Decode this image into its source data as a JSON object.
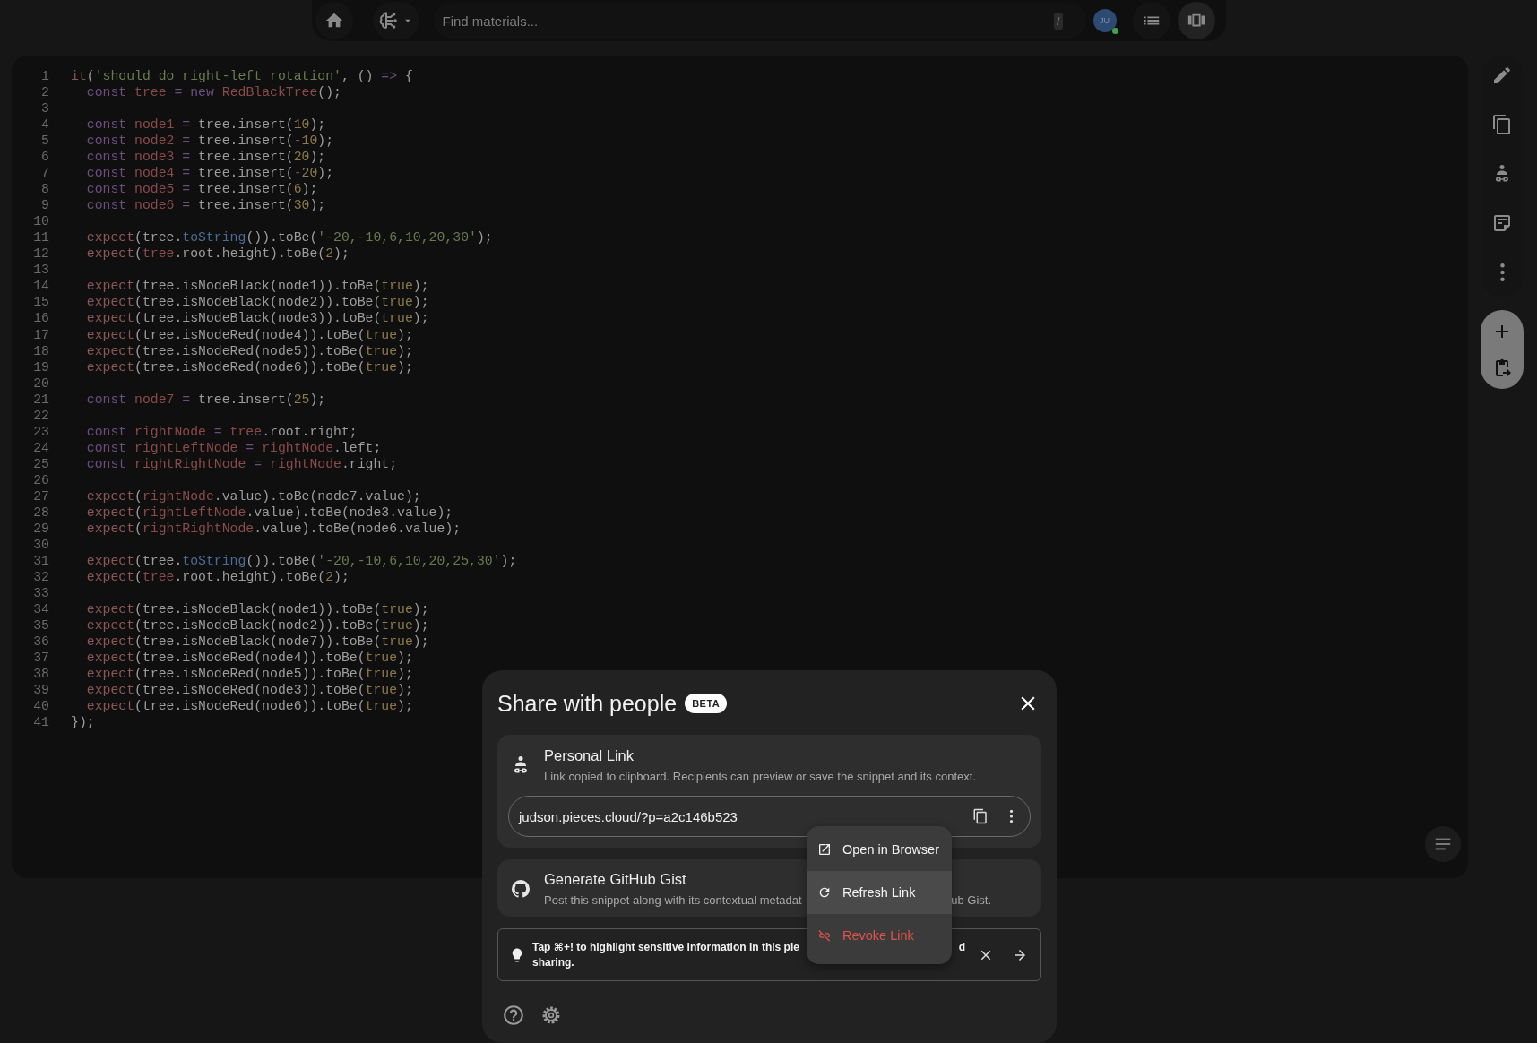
{
  "top_bar": {
    "search": {
      "placeholder": "Find materials..."
    },
    "shortcut": "/",
    "avatar": {
      "initials": "JU",
      "online": true
    }
  },
  "editor": {
    "lines": [
      {
        "number": "1",
        "tokens": [
          {
            "text": "it",
            "kind": "fn"
          },
          {
            "text": "(",
            "kind": "plain"
          },
          {
            "text": "'should do right-left rotation'",
            "kind": "str"
          },
          {
            "text": ", () ",
            "kind": "plain"
          },
          {
            "text": "=>",
            "kind": "kw"
          },
          {
            "text": " {",
            "kind": "plain"
          }
        ]
      },
      {
        "number": "2",
        "tokens": [
          {
            "text": "  const ",
            "kind": "kw"
          },
          {
            "text": "tree",
            "kind": "var"
          },
          {
            "text": " = new ",
            "kind": "kw"
          },
          {
            "text": "RedBlackTree",
            "kind": "var"
          },
          {
            "text": "();",
            "kind": "plain"
          }
        ]
      },
      {
        "number": "3"
      },
      {
        "number": "4",
        "tokens": [
          {
            "text": "  const ",
            "kind": "kw"
          },
          {
            "text": "node1",
            "kind": "var"
          },
          {
            "text": " = ",
            "kind": "kw"
          },
          {
            "text": "tree.insert(",
            "kind": "plain"
          },
          {
            "text": "10",
            "kind": "num"
          },
          {
            "text": ");",
            "kind": "plain"
          }
        ]
      },
      {
        "number": "5",
        "tokens": [
          {
            "text": "  const ",
            "kind": "kw"
          },
          {
            "text": "node2",
            "kind": "var"
          },
          {
            "text": " = ",
            "kind": "kw"
          },
          {
            "text": "tree.insert(",
            "kind": "plain"
          },
          {
            "text": "-",
            "kind": "kw"
          },
          {
            "text": "10",
            "kind": "num"
          },
          {
            "text": ");",
            "kind": "plain"
          }
        ]
      },
      {
        "number": "6",
        "tokens": [
          {
            "text": "  const ",
            "kind": "kw"
          },
          {
            "text": "node3",
            "kind": "var"
          },
          {
            "text": " = ",
            "kind": "kw"
          },
          {
            "text": "tree.insert(",
            "kind": "plain"
          },
          {
            "text": "20",
            "kind": "num"
          },
          {
            "text": ");",
            "kind": "plain"
          }
        ]
      },
      {
        "number": "7",
        "tokens": [
          {
            "text": "  const ",
            "kind": "kw"
          },
          {
            "text": "node4",
            "kind": "var"
          },
          {
            "text": " = ",
            "kind": "kw"
          },
          {
            "text": "tree.insert(",
            "kind": "plain"
          },
          {
            "text": "-",
            "kind": "kw"
          },
          {
            "text": "20",
            "kind": "num"
          },
          {
            "text": ");",
            "kind": "plain"
          }
        ]
      },
      {
        "number": "8",
        "tokens": [
          {
            "text": "  const ",
            "kind": "kw"
          },
          {
            "text": "node5",
            "kind": "var"
          },
          {
            "text": " = ",
            "kind": "kw"
          },
          {
            "text": "tree.insert(",
            "kind": "plain"
          },
          {
            "text": "6",
            "kind": "num"
          },
          {
            "text": ");",
            "kind": "plain"
          }
        ]
      },
      {
        "number": "9",
        "tokens": [
          {
            "text": "  const ",
            "kind": "kw"
          },
          {
            "text": "node6",
            "kind": "var"
          },
          {
            "text": " = ",
            "kind": "kw"
          },
          {
            "text": "tree.insert(",
            "kind": "plain"
          },
          {
            "text": "30",
            "kind": "num"
          },
          {
            "text": ");",
            "kind": "plain"
          }
        ]
      },
      {
        "number": "10"
      },
      {
        "number": "11",
        "tokens": [
          {
            "text": "  expect",
            "kind": "fn"
          },
          {
            "text": "(tree.",
            "kind": "plain"
          },
          {
            "text": "toString",
            "kind": "prop"
          },
          {
            "text": "()).toBe(",
            "kind": "plain"
          },
          {
            "text": "'-20,-10,6,10,20,30'",
            "kind": "str"
          },
          {
            "text": ");",
            "kind": "plain"
          }
        ]
      },
      {
        "number": "12",
        "tokens": [
          {
            "text": "  expect",
            "kind": "fn"
          },
          {
            "text": "(",
            "kind": "plain"
          },
          {
            "text": "tree",
            "kind": "var"
          },
          {
            "text": ".root.height).toBe(",
            "kind": "plain"
          },
          {
            "text": "2",
            "kind": "num"
          },
          {
            "text": ");",
            "kind": "plain"
          }
        ]
      },
      {
        "number": "13"
      },
      {
        "number": "14",
        "tokens": [
          {
            "text": "  expect",
            "kind": "fn"
          },
          {
            "text": "(tree.isNodeBlack(node1)).toBe(",
            "kind": "plain"
          },
          {
            "text": "true",
            "kind": "num"
          },
          {
            "text": ");",
            "kind": "plain"
          }
        ]
      },
      {
        "number": "15",
        "tokens": [
          {
            "text": "  expect",
            "kind": "fn"
          },
          {
            "text": "(tree.isNodeBlack(node2)).toBe(",
            "kind": "plain"
          },
          {
            "text": "true",
            "kind": "num"
          },
          {
            "text": ");",
            "kind": "plain"
          }
        ]
      },
      {
        "number": "16",
        "tokens": [
          {
            "text": "  expect",
            "kind": "fn"
          },
          {
            "text": "(tree.isNodeBlack(node3)).toBe(",
            "kind": "plain"
          },
          {
            "text": "true",
            "kind": "num"
          },
          {
            "text": ");",
            "kind": "plain"
          }
        ]
      },
      {
        "number": "17",
        "tokens": [
          {
            "text": "  expect",
            "kind": "fn"
          },
          {
            "text": "(tree.isNodeRed(node4)).toBe(",
            "kind": "plain"
          },
          {
            "text": "true",
            "kind": "num"
          },
          {
            "text": ");",
            "kind": "plain"
          }
        ]
      },
      {
        "number": "18",
        "tokens": [
          {
            "text": "  expect",
            "kind": "fn"
          },
          {
            "text": "(tree.isNodeRed(node5)).toBe(",
            "kind": "plain"
          },
          {
            "text": "true",
            "kind": "num"
          },
          {
            "text": ");",
            "kind": "plain"
          }
        ]
      },
      {
        "number": "19",
        "tokens": [
          {
            "text": "  expect",
            "kind": "fn"
          },
          {
            "text": "(tree.isNodeRed(node6)).toBe(",
            "kind": "plain"
          },
          {
            "text": "true",
            "kind": "num"
          },
          {
            "text": ");",
            "kind": "plain"
          }
        ]
      },
      {
        "number": "20"
      },
      {
        "number": "21",
        "tokens": [
          {
            "text": "  const ",
            "kind": "kw"
          },
          {
            "text": "node7",
            "kind": "var"
          },
          {
            "text": " = ",
            "kind": "kw"
          },
          {
            "text": "tree.insert(",
            "kind": "plain"
          },
          {
            "text": "25",
            "kind": "num"
          },
          {
            "text": ");",
            "kind": "plain"
          }
        ]
      },
      {
        "number": "22"
      },
      {
        "number": "23",
        "tokens": [
          {
            "text": "  const ",
            "kind": "kw"
          },
          {
            "text": "rightNode",
            "kind": "var"
          },
          {
            "text": " = ",
            "kind": "kw"
          },
          {
            "text": "tree",
            "kind": "var"
          },
          {
            "text": ".root.right;",
            "kind": "plain"
          }
        ]
      },
      {
        "number": "24",
        "tokens": [
          {
            "text": "  const ",
            "kind": "kw"
          },
          {
            "text": "rightLeftNode",
            "kind": "var"
          },
          {
            "text": " = ",
            "kind": "kw"
          },
          {
            "text": "rightNode",
            "kind": "var"
          },
          {
            "text": ".left;",
            "kind": "plain"
          }
        ]
      },
      {
        "number": "25",
        "tokens": [
          {
            "text": "  const ",
            "kind": "kw"
          },
          {
            "text": "rightRightNode",
            "kind": "var"
          },
          {
            "text": " = ",
            "kind": "kw"
          },
          {
            "text": "rightNode",
            "kind": "var"
          },
          {
            "text": ".right;",
            "kind": "plain"
          }
        ]
      },
      {
        "number": "26"
      },
      {
        "number": "27",
        "tokens": [
          {
            "text": "  expect",
            "kind": "fn"
          },
          {
            "text": "(",
            "kind": "plain"
          },
          {
            "text": "rightNode",
            "kind": "var"
          },
          {
            "text": ".value).toBe(node7.value);",
            "kind": "plain"
          }
        ]
      },
      {
        "number": "28",
        "tokens": [
          {
            "text": "  expect",
            "kind": "fn"
          },
          {
            "text": "(",
            "kind": "plain"
          },
          {
            "text": "rightLeftNode",
            "kind": "var"
          },
          {
            "text": ".value).toBe(node3.value);",
            "kind": "plain"
          }
        ]
      },
      {
        "number": "29",
        "tokens": [
          {
            "text": "  expect",
            "kind": "fn"
          },
          {
            "text": "(",
            "kind": "plain"
          },
          {
            "text": "rightRightNode",
            "kind": "var"
          },
          {
            "text": ".value).toBe(node6.value);",
            "kind": "plain"
          }
        ]
      },
      {
        "number": "30"
      },
      {
        "number": "31",
        "tokens": [
          {
            "text": "  expect",
            "kind": "fn"
          },
          {
            "text": "(tree.",
            "kind": "plain"
          },
          {
            "text": "toString",
            "kind": "prop"
          },
          {
            "text": "()).toBe(",
            "kind": "plain"
          },
          {
            "text": "'-20,-10,6,10,20,25,30'",
            "kind": "str"
          },
          {
            "text": ");",
            "kind": "plain"
          }
        ]
      },
      {
        "number": "32",
        "tokens": [
          {
            "text": "  expect",
            "kind": "fn"
          },
          {
            "text": "(",
            "kind": "plain"
          },
          {
            "text": "tree",
            "kind": "var"
          },
          {
            "text": ".root.height).toBe(",
            "kind": "plain"
          },
          {
            "text": "2",
            "kind": "num"
          },
          {
            "text": ");",
            "kind": "plain"
          }
        ]
      },
      {
        "number": "33"
      },
      {
        "number": "34",
        "tokens": [
          {
            "text": "  expect",
            "kind": "fn"
          },
          {
            "text": "(tree.isNodeBlack(node1)).toBe(",
            "kind": "plain"
          },
          {
            "text": "true",
            "kind": "num"
          },
          {
            "text": ");",
            "kind": "plain"
          }
        ]
      },
      {
        "number": "35",
        "tokens": [
          {
            "text": "  expect",
            "kind": "fn"
          },
          {
            "text": "(tree.isNodeBlack(node2)).toBe(",
            "kind": "plain"
          },
          {
            "text": "true",
            "kind": "num"
          },
          {
            "text": ");",
            "kind": "plain"
          }
        ]
      },
      {
        "number": "36",
        "tokens": [
          {
            "text": "  expect",
            "kind": "fn"
          },
          {
            "text": "(tree.isNodeBlack(node7)).toBe(",
            "kind": "plain"
          },
          {
            "text": "true",
            "kind": "num"
          },
          {
            "text": ");",
            "kind": "plain"
          }
        ]
      },
      {
        "number": "37",
        "tokens": [
          {
            "text": "  expect",
            "kind": "fn"
          },
          {
            "text": "(tree.isNodeRed(node4)).toBe(",
            "kind": "plain"
          },
          {
            "text": "true",
            "kind": "num"
          },
          {
            "text": ");",
            "kind": "plain"
          }
        ]
      },
      {
        "number": "38",
        "tokens": [
          {
            "text": "  expect",
            "kind": "fn"
          },
          {
            "text": "(tree.isNodeRed(node5)).toBe(",
            "kind": "plain"
          },
          {
            "text": "true",
            "kind": "num"
          },
          {
            "text": ");",
            "kind": "plain"
          }
        ]
      },
      {
        "number": "39",
        "tokens": [
          {
            "text": "  expect",
            "kind": "fn"
          },
          {
            "text": "(tree.isNodeRed(node3)).toBe(",
            "kind": "plain"
          },
          {
            "text": "true",
            "kind": "num"
          },
          {
            "text": ");",
            "kind": "plain"
          }
        ]
      },
      {
        "number": "40",
        "tokens": [
          {
            "text": "  expect",
            "kind": "fn"
          },
          {
            "text": "(tree.isNodeRed(node6)).toBe(",
            "kind": "plain"
          },
          {
            "text": "true",
            "kind": "num"
          },
          {
            "text": ");",
            "kind": "plain"
          }
        ]
      },
      {
        "number": "41",
        "tokens": [
          {
            "text": "});",
            "kind": "plain"
          }
        ]
      }
    ]
  },
  "share_dialog": {
    "title": "Share with people",
    "badge": "BETA",
    "personal_link": {
      "title": "Personal Link",
      "description": "Link copied to clipboard. Recipients can preview or save the snippet and its context.",
      "url": "judson.pieces.cloud/?p=a2c146b523"
    },
    "gist": {
      "title": "Generate GitHub Gist",
      "description_visible_start": "Post this snippet along with its contextual metadat",
      "description_visible_end": "ub Gist."
    },
    "tip": {
      "line_1_start": "Tap ⌘+! to highlight sensitive information in this pie",
      "line_1_end": "d",
      "line_2": "sharing."
    },
    "menu": [
      {
        "label": "Open in Browser",
        "kind": "normal",
        "highlighted": false
      },
      {
        "label": "Refresh Link",
        "kind": "normal",
        "highlighted": true
      },
      {
        "label": "Revoke Link",
        "kind": "danger",
        "highlighted": false
      }
    ]
  }
}
